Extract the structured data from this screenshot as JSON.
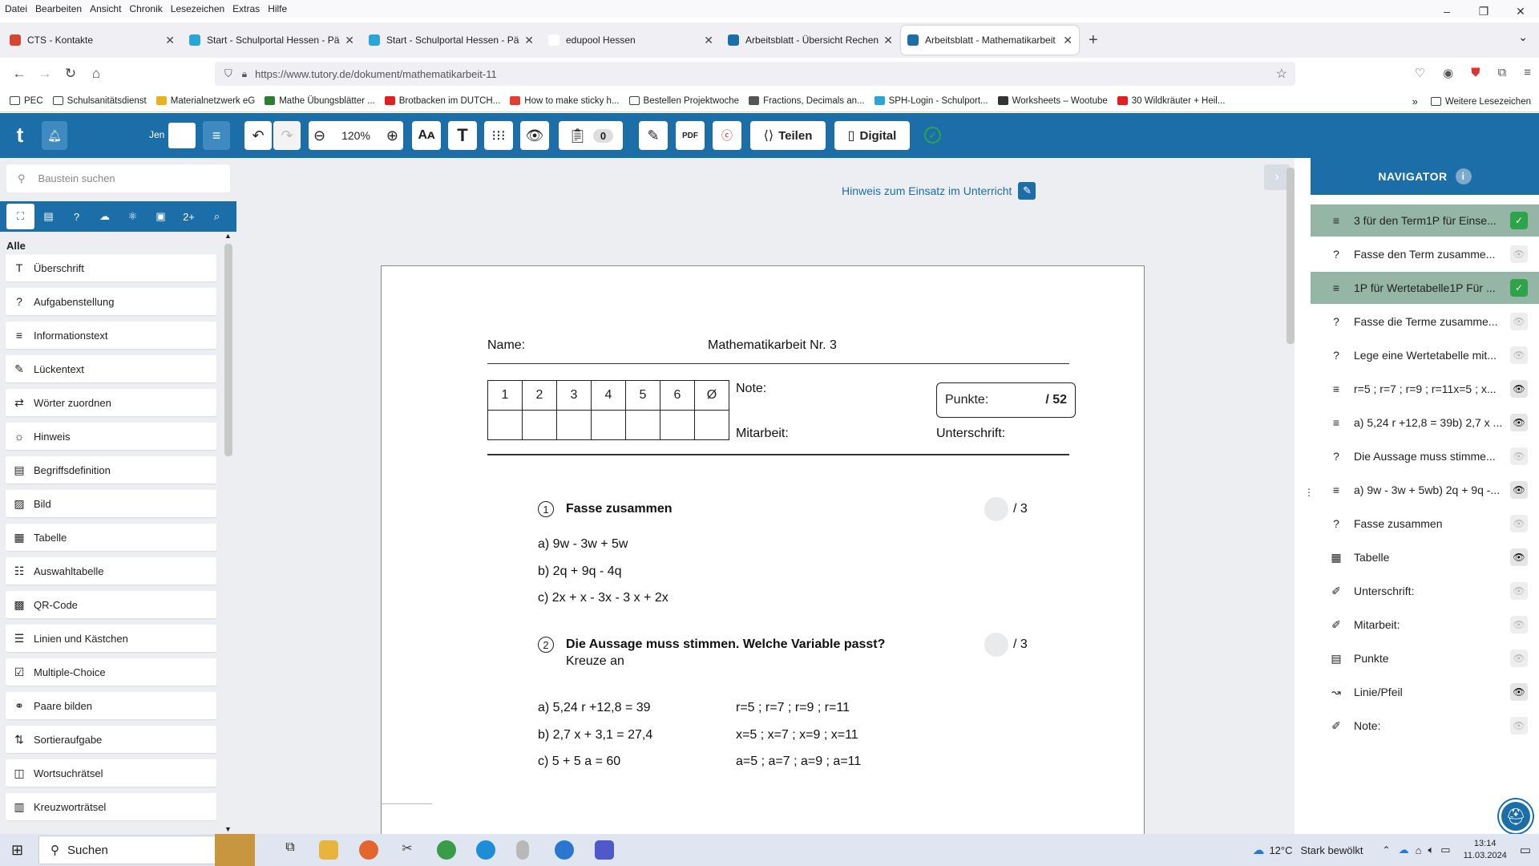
{
  "menu": [
    "Datei",
    "Bearbeiten",
    "Ansicht",
    "Chronik",
    "Lesezeichen",
    "Extras",
    "Hilfe"
  ],
  "window_controls": {
    "minimize": "–",
    "restore": "❐",
    "close": "✕"
  },
  "tabs": [
    {
      "label": "CTS - Kontakte",
      "color": "#d6452f"
    },
    {
      "label": "Start - Schulportal Hessen - Päd",
      "color": "#2aa5d8"
    },
    {
      "label": "Start - Schulportal Hessen - Päd",
      "color": "#2aa5d8"
    },
    {
      "label": "edupool Hessen",
      "color": "#ffffff"
    },
    {
      "label": "Arbeitsblatt - Übersicht Rechen",
      "color": "#1b6ea8"
    },
    {
      "label": "Arbeitsblatt - Mathematikarbeit",
      "color": "#1b6ea8"
    }
  ],
  "url": "https://www.tutory.de/dokument/mathematikarbeit-11",
  "bookmarks": [
    {
      "label": "PEC",
      "color": ""
    },
    {
      "label": "Schulsanitätsdienst",
      "color": ""
    },
    {
      "label": "Materialnetzwerk eG",
      "color": "#e6b31e"
    },
    {
      "label": "Mathe Übungsblätter ...",
      "color": "#2e7d32"
    },
    {
      "label": "Brotbacken im DUTCH...",
      "color": "#e02020"
    },
    {
      "label": "How to make sticky h...",
      "color": "#e04030"
    },
    {
      "label": "Bestellen Projektwoche",
      "color": ""
    },
    {
      "label": "Fractions, Decimals an...",
      "color": "#555555"
    },
    {
      "label": "SPH-Login - Schulport...",
      "color": "#2aa5d8"
    },
    {
      "label": "Worksheets – Wootube",
      "color": "#333333"
    },
    {
      "label": "30 Wildkräuter + Heil...",
      "color": "#e02020"
    }
  ],
  "bookmarks_more": "Weitere Lesezeichen",
  "toolbar": {
    "user": "Jen",
    "zoom": "120%",
    "counter": "0",
    "share": "Teilen",
    "digital": "Digital"
  },
  "sidebar": {
    "search_placeholder": "Baustein suchen",
    "section": "Alle",
    "items": [
      {
        "label": "Überschrift",
        "icon": "T"
      },
      {
        "label": "Aufgabenstellung",
        "icon": "?"
      },
      {
        "label": "Informationstext",
        "icon": "≡"
      },
      {
        "label": "Lückentext",
        "icon": "✎"
      },
      {
        "label": "Wörter zuordnen",
        "icon": "⇄"
      },
      {
        "label": "Hinweis",
        "icon": "☼"
      },
      {
        "label": "Begriffsdefinition",
        "icon": "▤"
      },
      {
        "label": "Bild",
        "icon": "▨"
      },
      {
        "label": "Tabelle",
        "icon": "▦"
      },
      {
        "label": "Auswahltabelle",
        "icon": "☷"
      },
      {
        "label": "QR-Code",
        "icon": "▩"
      },
      {
        "label": "Linien und Kästchen",
        "icon": "☰"
      },
      {
        "label": "Multiple-Choice",
        "icon": "☑"
      },
      {
        "label": "Paare bilden",
        "icon": "⚭"
      },
      {
        "label": "Sortieraufgabe",
        "icon": "⇅"
      },
      {
        "label": "Wortsuchrätsel",
        "icon": "◫"
      },
      {
        "label": "Kreuzworträtsel",
        "icon": "▥"
      }
    ]
  },
  "hint_link": "Hinweis zum Einsatz im Unterricht",
  "worksheet": {
    "name_label": "Name:",
    "title": "Mathematikarbeit Nr. 3",
    "grid_headers": [
      "1",
      "2",
      "3",
      "4",
      "5",
      "6",
      "Ø"
    ],
    "note_label": "Note:",
    "mitarbeit_label": "Mitarbeit:",
    "punkte_label": "Punkte:",
    "punkte_total": "/ 52",
    "unterschrift_label": "Unterschrift:",
    "task1": {
      "number": "1",
      "title": "Fasse zusammen",
      "score": "/ 3",
      "lines": [
        "a) 9w - 3w + 5w",
        "b) 2q + 9q - 4q",
        "c) 2x + x - 3x - 3 x + 2x"
      ]
    },
    "task2": {
      "number": "2",
      "title": "Die Aussage muss stimmen. Welche Variable passt?",
      "subtitle": "Kreuze an",
      "score": "/ 3",
      "equations": [
        "a) 5,24 r +12,8 = 39",
        "b) 2,7 x + 3,1 = 27,4",
        "c) 5 + 5 a = 60"
      ],
      "options": [
        "r=5 ; r=7 ; r=9 ; r=11",
        "x=5 ; x=7 ; x=9 ; x=11",
        "a=5 ; a=7 ; a=9 ; a=11"
      ]
    }
  },
  "navigator": {
    "title": "NAVIGATOR",
    "items": [
      {
        "label": "3 für den Term1P für Einse...",
        "icon": "≡",
        "state": "check",
        "hl": true
      },
      {
        "label": "Fasse den Term zusamme...",
        "icon": "?",
        "state": "eye",
        "hl": false
      },
      {
        "label": "1P für Wertetabelle1P Für ...",
        "icon": "≡",
        "state": "check",
        "hl": true
      },
      {
        "label": "Fasse die Terme zusamme...",
        "icon": "?",
        "state": "eye",
        "hl": false
      },
      {
        "label": "Lege eine Wertetabelle mit...",
        "icon": "?",
        "state": "eye",
        "hl": false
      },
      {
        "label": "r=5 ; r=7 ; r=9 ; r=11x=5 ; x...",
        "icon": "≡",
        "state": "eyeon",
        "hl": false
      },
      {
        "label": "a) 5,24 r +12,8 = 39b) 2,7 x ...",
        "icon": "≡",
        "state": "eyeon",
        "hl": false
      },
      {
        "label": "Die Aussage muss stimme...",
        "icon": "?",
        "state": "eye",
        "hl": false
      },
      {
        "label": "a) 9w - 3w + 5wb) 2q + 9q -...",
        "icon": "≡",
        "state": "eyeon",
        "hl": false
      },
      {
        "label": "Fasse zusammen",
        "icon": "?",
        "state": "eye",
        "hl": false
      },
      {
        "label": "Tabelle",
        "icon": "▦",
        "state": "eyeon",
        "hl": false
      },
      {
        "label": "Unterschrift:",
        "icon": "✐",
        "state": "eye",
        "hl": false
      },
      {
        "label": "Mitarbeit:",
        "icon": "✐",
        "state": "eye",
        "hl": false
      },
      {
        "label": "Punkte",
        "icon": "▤",
        "state": "eye",
        "hl": false
      },
      {
        "label": "Linie/Pfeil",
        "icon": "↝",
        "state": "eyeon",
        "hl": false
      },
      {
        "label": "Note:",
        "icon": "✐",
        "state": "eye",
        "hl": false
      }
    ]
  },
  "taskbar": {
    "search": "Suchen",
    "weather": "12°C",
    "weather_text": "Stark bewölkt",
    "time": "13:14",
    "date": "11.03.2024"
  }
}
